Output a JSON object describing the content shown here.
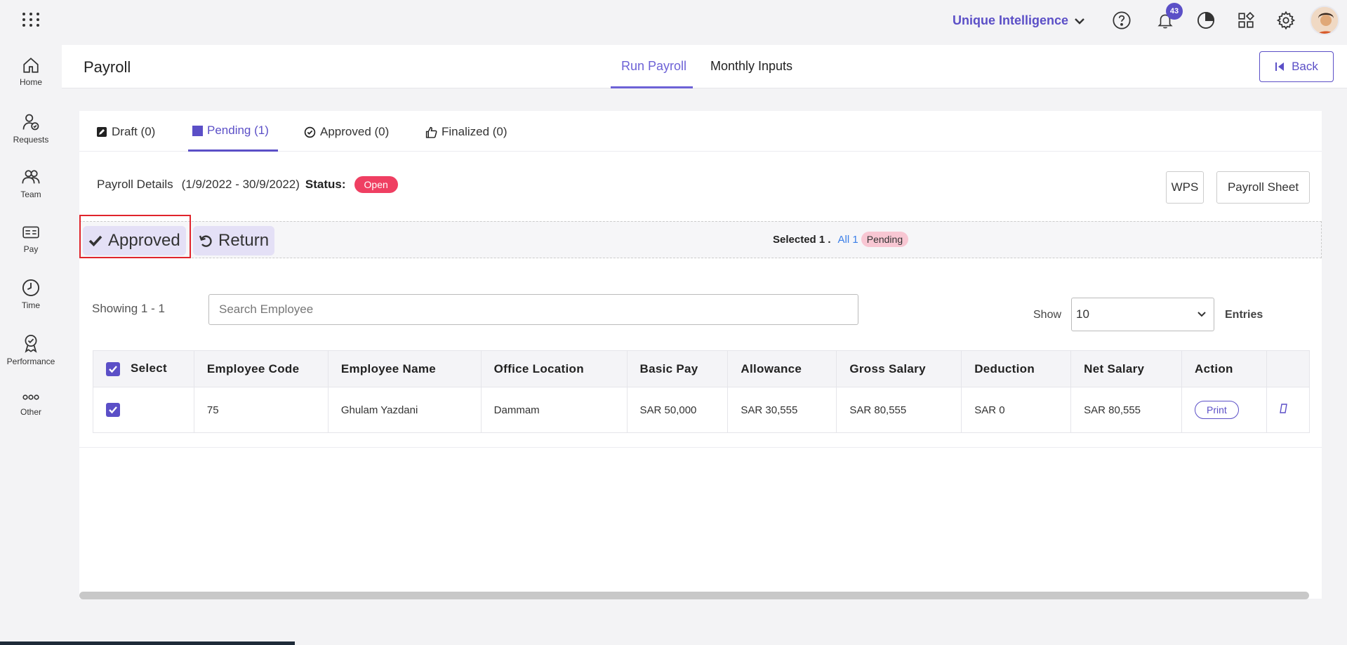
{
  "sidebar": {
    "items": [
      {
        "label": "Home",
        "icon": "home-icon"
      },
      {
        "label": "Requests",
        "icon": "requests-icon"
      },
      {
        "label": "Team",
        "icon": "team-icon"
      },
      {
        "label": "Pay",
        "icon": "pay-icon"
      },
      {
        "label": "Time",
        "icon": "clock-icon"
      },
      {
        "label": "Performance",
        "icon": "performance-icon"
      },
      {
        "label": "Other",
        "icon": "more-icon"
      }
    ]
  },
  "topbar": {
    "company": "Unique Intelligence",
    "notification_count": "43"
  },
  "header": {
    "title": "Payroll",
    "tabs": [
      {
        "label": "Run Payroll",
        "active": true
      },
      {
        "label": "Monthly Inputs",
        "active": false
      }
    ],
    "back_label": "Back"
  },
  "subtabs": [
    {
      "label": "Draft (0)",
      "icon": "edit-icon"
    },
    {
      "label": "Pending (1)",
      "icon": "square-icon",
      "active": true
    },
    {
      "label": "Approved (0)",
      "icon": "check-circle-icon"
    },
    {
      "label": "Finalized (0)",
      "icon": "thumbs-up-icon"
    }
  ],
  "details": {
    "label": "Payroll Details",
    "period": "(1/9/2022 - 30/9/2022)",
    "status_label": "Status:",
    "status_value": "Open",
    "wps_label": "WPS",
    "sheet_label": "Payroll Sheet"
  },
  "actions": {
    "approve_label": "Approved",
    "return_label": "Return",
    "selected_text": "Selected 1 .",
    "all_text": "All 1",
    "pending_text": "Pending"
  },
  "list": {
    "showing": "Showing 1 - 1",
    "search_placeholder": "Search Employee",
    "show_label": "Show",
    "entries_value": "10",
    "entries_label": "Entries"
  },
  "table": {
    "headers": [
      "Select",
      "Employee Code",
      "Employee Name",
      "Office Location",
      "Basic Pay",
      "Allowance",
      "Gross Salary",
      "Deduction",
      "Net Salary",
      "Action"
    ],
    "rows": [
      {
        "code": "75",
        "name": "Ghulam Yazdani",
        "location": "Dammam",
        "basic": "SAR 50,000",
        "allowance": "SAR 30,555",
        "gross": "SAR 80,555",
        "deduction": "SAR 0",
        "net": "SAR 80,555",
        "action": "Print"
      }
    ]
  },
  "colors": {
    "accent": "#5b4fc7",
    "status_open": "#ef3f62",
    "pending_pill": "#f8c7d3",
    "highlight": "#e0242c"
  }
}
